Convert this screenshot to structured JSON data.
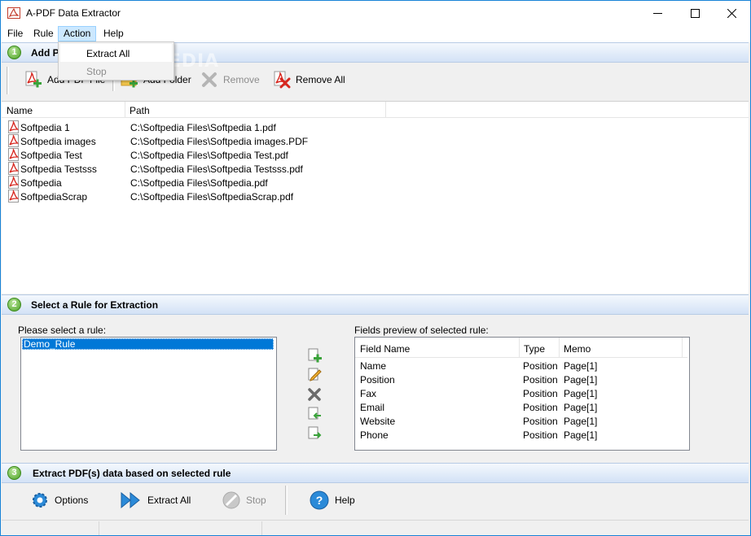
{
  "window": {
    "title": "A-PDF Data Extractor",
    "border_color": "#1883d7"
  },
  "menu": {
    "items": [
      "File",
      "Rule",
      "Action",
      "Help"
    ],
    "active": "Action",
    "dropdown": {
      "items": [
        {
          "label": "Extract All",
          "enabled": true
        },
        {
          "label": "Stop",
          "enabled": false
        }
      ]
    }
  },
  "watermark": "SOFTPEDIA",
  "section1": {
    "number": "1",
    "title": "Add P",
    "toolbar": {
      "add_file": "Add PDF File",
      "add_folder": "Add Folder",
      "remove": "Remove",
      "remove_all": "Remove All"
    }
  },
  "file_list": {
    "columns": [
      "Name",
      "Path"
    ],
    "rows": [
      {
        "name": "Softpedia 1",
        "path": "C:\\Softpedia Files\\Softpedia 1.pdf"
      },
      {
        "name": "Softpedia images",
        "path": "C:\\Softpedia Files\\Softpedia images.PDF"
      },
      {
        "name": "Softpedia Test",
        "path": "C:\\Softpedia Files\\Softpedia Test.pdf"
      },
      {
        "name": "Softpedia Testsss",
        "path": "C:\\Softpedia Files\\Softpedia Testsss.pdf"
      },
      {
        "name": "Softpedia",
        "path": "C:\\Softpedia Files\\Softpedia.pdf"
      },
      {
        "name": "SoftpediaScrap",
        "path": "C:\\Softpedia Files\\SoftpediaScrap.pdf"
      }
    ]
  },
  "section2": {
    "number": "2",
    "title": "Select a Rule for Extraction",
    "rule_caption": "Please select a rule:",
    "rules": [
      "Demo_Rule"
    ],
    "selected_rule": "Demo_Rule",
    "fields_caption": "Fields preview of selected rule:",
    "field_columns": [
      "Field Name",
      "Type",
      "Memo"
    ],
    "fields": [
      {
        "name": "Name",
        "type": "Position",
        "memo": "Page[1]"
      },
      {
        "name": "Position",
        "type": "Position",
        "memo": "Page[1]"
      },
      {
        "name": "Fax",
        "type": "Position",
        "memo": "Page[1]"
      },
      {
        "name": "Email",
        "type": "Position",
        "memo": "Page[1]"
      },
      {
        "name": "Website",
        "type": "Position",
        "memo": "Page[1]"
      },
      {
        "name": "Phone",
        "type": "Position",
        "memo": "Page[1]"
      }
    ]
  },
  "section3": {
    "number": "3",
    "title": "Extract PDF(s) data based on selected rule",
    "buttons": {
      "options": "Options",
      "extract_all": "Extract All",
      "stop": "Stop",
      "help": "Help"
    }
  },
  "colors": {
    "selection": "#0078d7",
    "pdf_red": "#d7261e",
    "add_green": "#3aa33a",
    "section_gradient_top": "#f4f8fd",
    "section_gradient_bottom": "#d3e2f6"
  }
}
